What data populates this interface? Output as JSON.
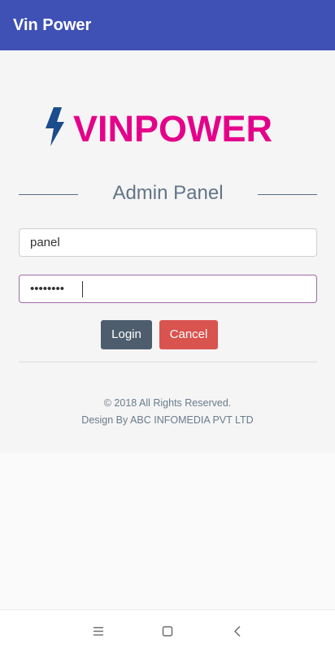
{
  "app_bar": {
    "title": "Vin Power"
  },
  "logo": {
    "wordmark": "VINPOWER",
    "bolt_color": "#1b4c8c",
    "text_color": "#e5008a"
  },
  "heading": "Admin Panel",
  "form": {
    "username_value": "panel",
    "password_value": "••••••••"
  },
  "buttons": {
    "login": "Login",
    "cancel": "Cancel"
  },
  "footer": {
    "copyright": "© 2018 All Rights Reserved.",
    "credit": "Design By ABC INFOMEDIA PVT LTD"
  },
  "colors": {
    "app_bar": "#3f51b5",
    "login_button": "#4d5d6e",
    "cancel_button": "#d9534f"
  },
  "system_nav": {
    "icons": [
      "menu-icon",
      "home-icon",
      "back-icon"
    ]
  }
}
